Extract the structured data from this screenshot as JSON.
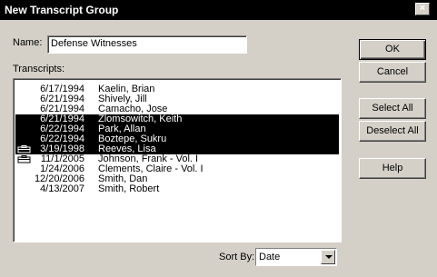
{
  "window": {
    "title": "New Transcript Group",
    "close_glyph": "×"
  },
  "form": {
    "name_label": "Name:",
    "name_value": "Defense Witnesses",
    "transcripts_label": "Transcripts:",
    "sort_by_label": "Sort By:",
    "sort_by_value": "Date"
  },
  "transcripts": [
    {
      "date": "6/17/1994",
      "name": "Kaelin, Brian",
      "selected": false,
      "icon": ""
    },
    {
      "date": "6/21/1994",
      "name": "Shively, Jill",
      "selected": false,
      "icon": ""
    },
    {
      "date": "6/21/1994",
      "name": "Camacho, Jose",
      "selected": false,
      "icon": ""
    },
    {
      "date": "6/21/1994",
      "name": "Zlomsowitch, Keith",
      "selected": true,
      "icon": ""
    },
    {
      "date": "6/22/1994",
      "name": "Park, Allan",
      "selected": true,
      "icon": ""
    },
    {
      "date": "6/22/1994",
      "name": "Boztepe, Sukru",
      "selected": true,
      "icon": ""
    },
    {
      "date": "3/19/1998",
      "name": "Reeves, Lisa",
      "selected": true,
      "icon": "briefcase-icon"
    },
    {
      "date": "11/1/2005",
      "name": "Johnson, Frank - Vol. I",
      "selected": false,
      "icon": "briefcase-icon"
    },
    {
      "date": "1/24/2006",
      "name": "Clements, Claire - Vol. I",
      "selected": false,
      "icon": ""
    },
    {
      "date": "12/20/2006",
      "name": "Smith, Dan",
      "selected": false,
      "icon": ""
    },
    {
      "date": "4/13/2007",
      "name": "Smith, Robert",
      "selected": false,
      "icon": ""
    }
  ],
  "buttons": {
    "ok": "OK",
    "cancel": "Cancel",
    "select_all": "Select All",
    "deselect_all": "Deselect All",
    "help": "Help"
  }
}
